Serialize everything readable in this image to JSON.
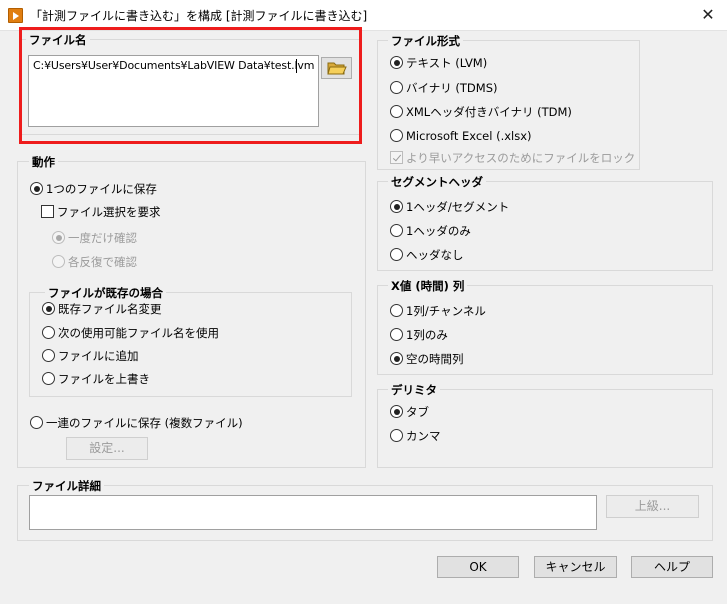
{
  "window": {
    "title": "「計測ファイルに書き込む」を構成 [計測ファイルに書き込む]",
    "close_glyph": "✕"
  },
  "file_name": {
    "label": "ファイル名",
    "path_value": "C:¥Users¥User¥Documents¥LabVIEW Data¥test.lvm"
  },
  "action": {
    "label": "動作",
    "save_single": "1つのファイルに保存",
    "ask_user": "ファイル選択を要求",
    "ask_once": "一度だけ確認",
    "ask_each": "各反復で確認",
    "if_exists": {
      "label": "ファイルが既存の場合",
      "rename": "既存ファイル名変更",
      "next_available": "次の使用可能ファイル名を使用",
      "append": "ファイルに追加",
      "overwrite": "ファイルを上書き"
    },
    "save_series": "一連のファイルに保存 (複数ファイル)",
    "settings_button": "設定..."
  },
  "file_format": {
    "label": "ファイル形式",
    "text_lvm": "テキスト (LVM)",
    "binary_tdms": "バイナリ (TDMS)",
    "binary_tdm": "XMLヘッダ付きバイナリ (TDM)",
    "excel": "Microsoft Excel (.xlsx)",
    "lock_file": "より早いアクセスのためにファイルをロック"
  },
  "segment_header": {
    "label": "セグメントヘッダ",
    "per_segment": "1ヘッダ/セグメント",
    "only_one": "1ヘッダのみ",
    "none": "ヘッダなし"
  },
  "x_value": {
    "label": "X値 (時間) 列",
    "per_channel": "1列/チャンネル",
    "one_column": "1列のみ",
    "empty": "空の時間列"
  },
  "delimiter": {
    "label": "デリミタ",
    "tab": "タブ",
    "comma": "カンマ"
  },
  "file_details": {
    "label": "ファイル詳細",
    "advanced_button": "上級..."
  },
  "footer": {
    "ok": "OK",
    "cancel": "キャンセル",
    "help": "ヘルプ"
  },
  "colors": {
    "highlight": "#ee1c1c",
    "app_icon": "#e07e11"
  }
}
